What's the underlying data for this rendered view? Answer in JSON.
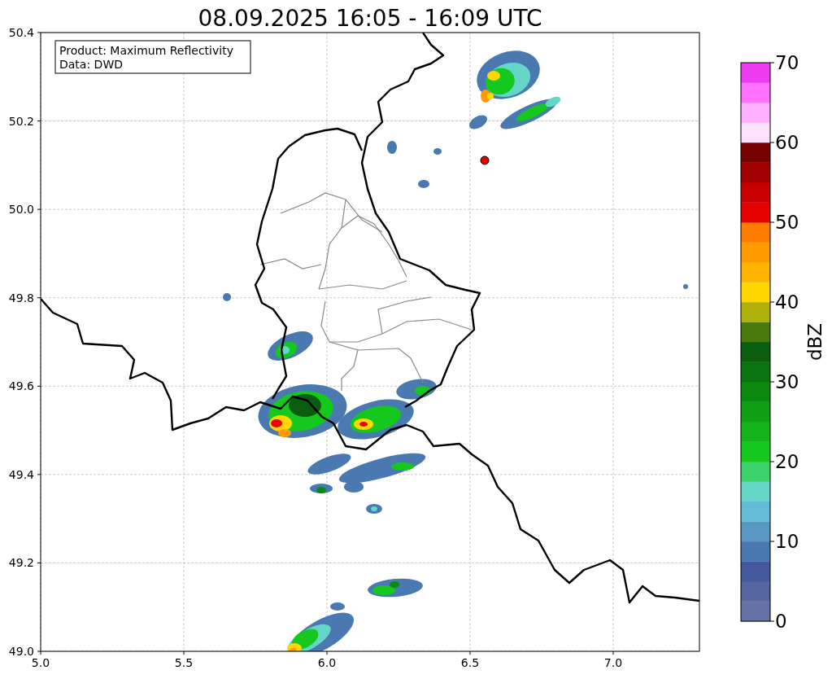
{
  "title": "08.09.2025 16:05 - 16:09 UTC",
  "info_box": {
    "lines": [
      "Product: Maximum Reflectivity",
      "Data: DWD"
    ]
  },
  "x_axis": {
    "ticks": [
      "5.0",
      "5.5",
      "6.0",
      "6.5",
      "7.0"
    ]
  },
  "y_axis": {
    "ticks": [
      "50.4",
      "50.2",
      "50.0",
      "49.8",
      "49.6",
      "49.4",
      "49.2",
      "49.0"
    ]
  },
  "colorbar": {
    "label": "dBZ",
    "ticks": [
      "70",
      "60",
      "50",
      "40",
      "30",
      "20",
      "10",
      "0"
    ],
    "bins": [
      {
        "color": "#6373a6"
      },
      {
        "color": "#5566a0"
      },
      {
        "color": "#44599c"
      },
      {
        "color": "#4a78b0"
      },
      {
        "color": "#5a98c4"
      },
      {
        "color": "#64bcd8"
      },
      {
        "color": "#64d6c8"
      },
      {
        "color": "#3ed36a"
      },
      {
        "color": "#14c81e"
      },
      {
        "color": "#12b41a"
      },
      {
        "color": "#0f9e14"
      },
      {
        "color": "#0b8a10"
      },
      {
        "color": "#0a7410"
      },
      {
        "color": "#0a5c0e"
      },
      {
        "color": "#4a7a0e"
      },
      {
        "color": "#b0b00a"
      },
      {
        "color": "#ffd700"
      },
      {
        "color": "#ffb400"
      },
      {
        "color": "#ff9a00"
      },
      {
        "color": "#ff7c00"
      },
      {
        "color": "#e60000"
      },
      {
        "color": "#c80000"
      },
      {
        "color": "#a00000"
      },
      {
        "color": "#780000"
      },
      {
        "color": "#ffe0ff"
      },
      {
        "color": "#ffb0ff"
      },
      {
        "color": "#ff70ff"
      },
      {
        "color": "#f03cf0"
      }
    ]
  }
}
